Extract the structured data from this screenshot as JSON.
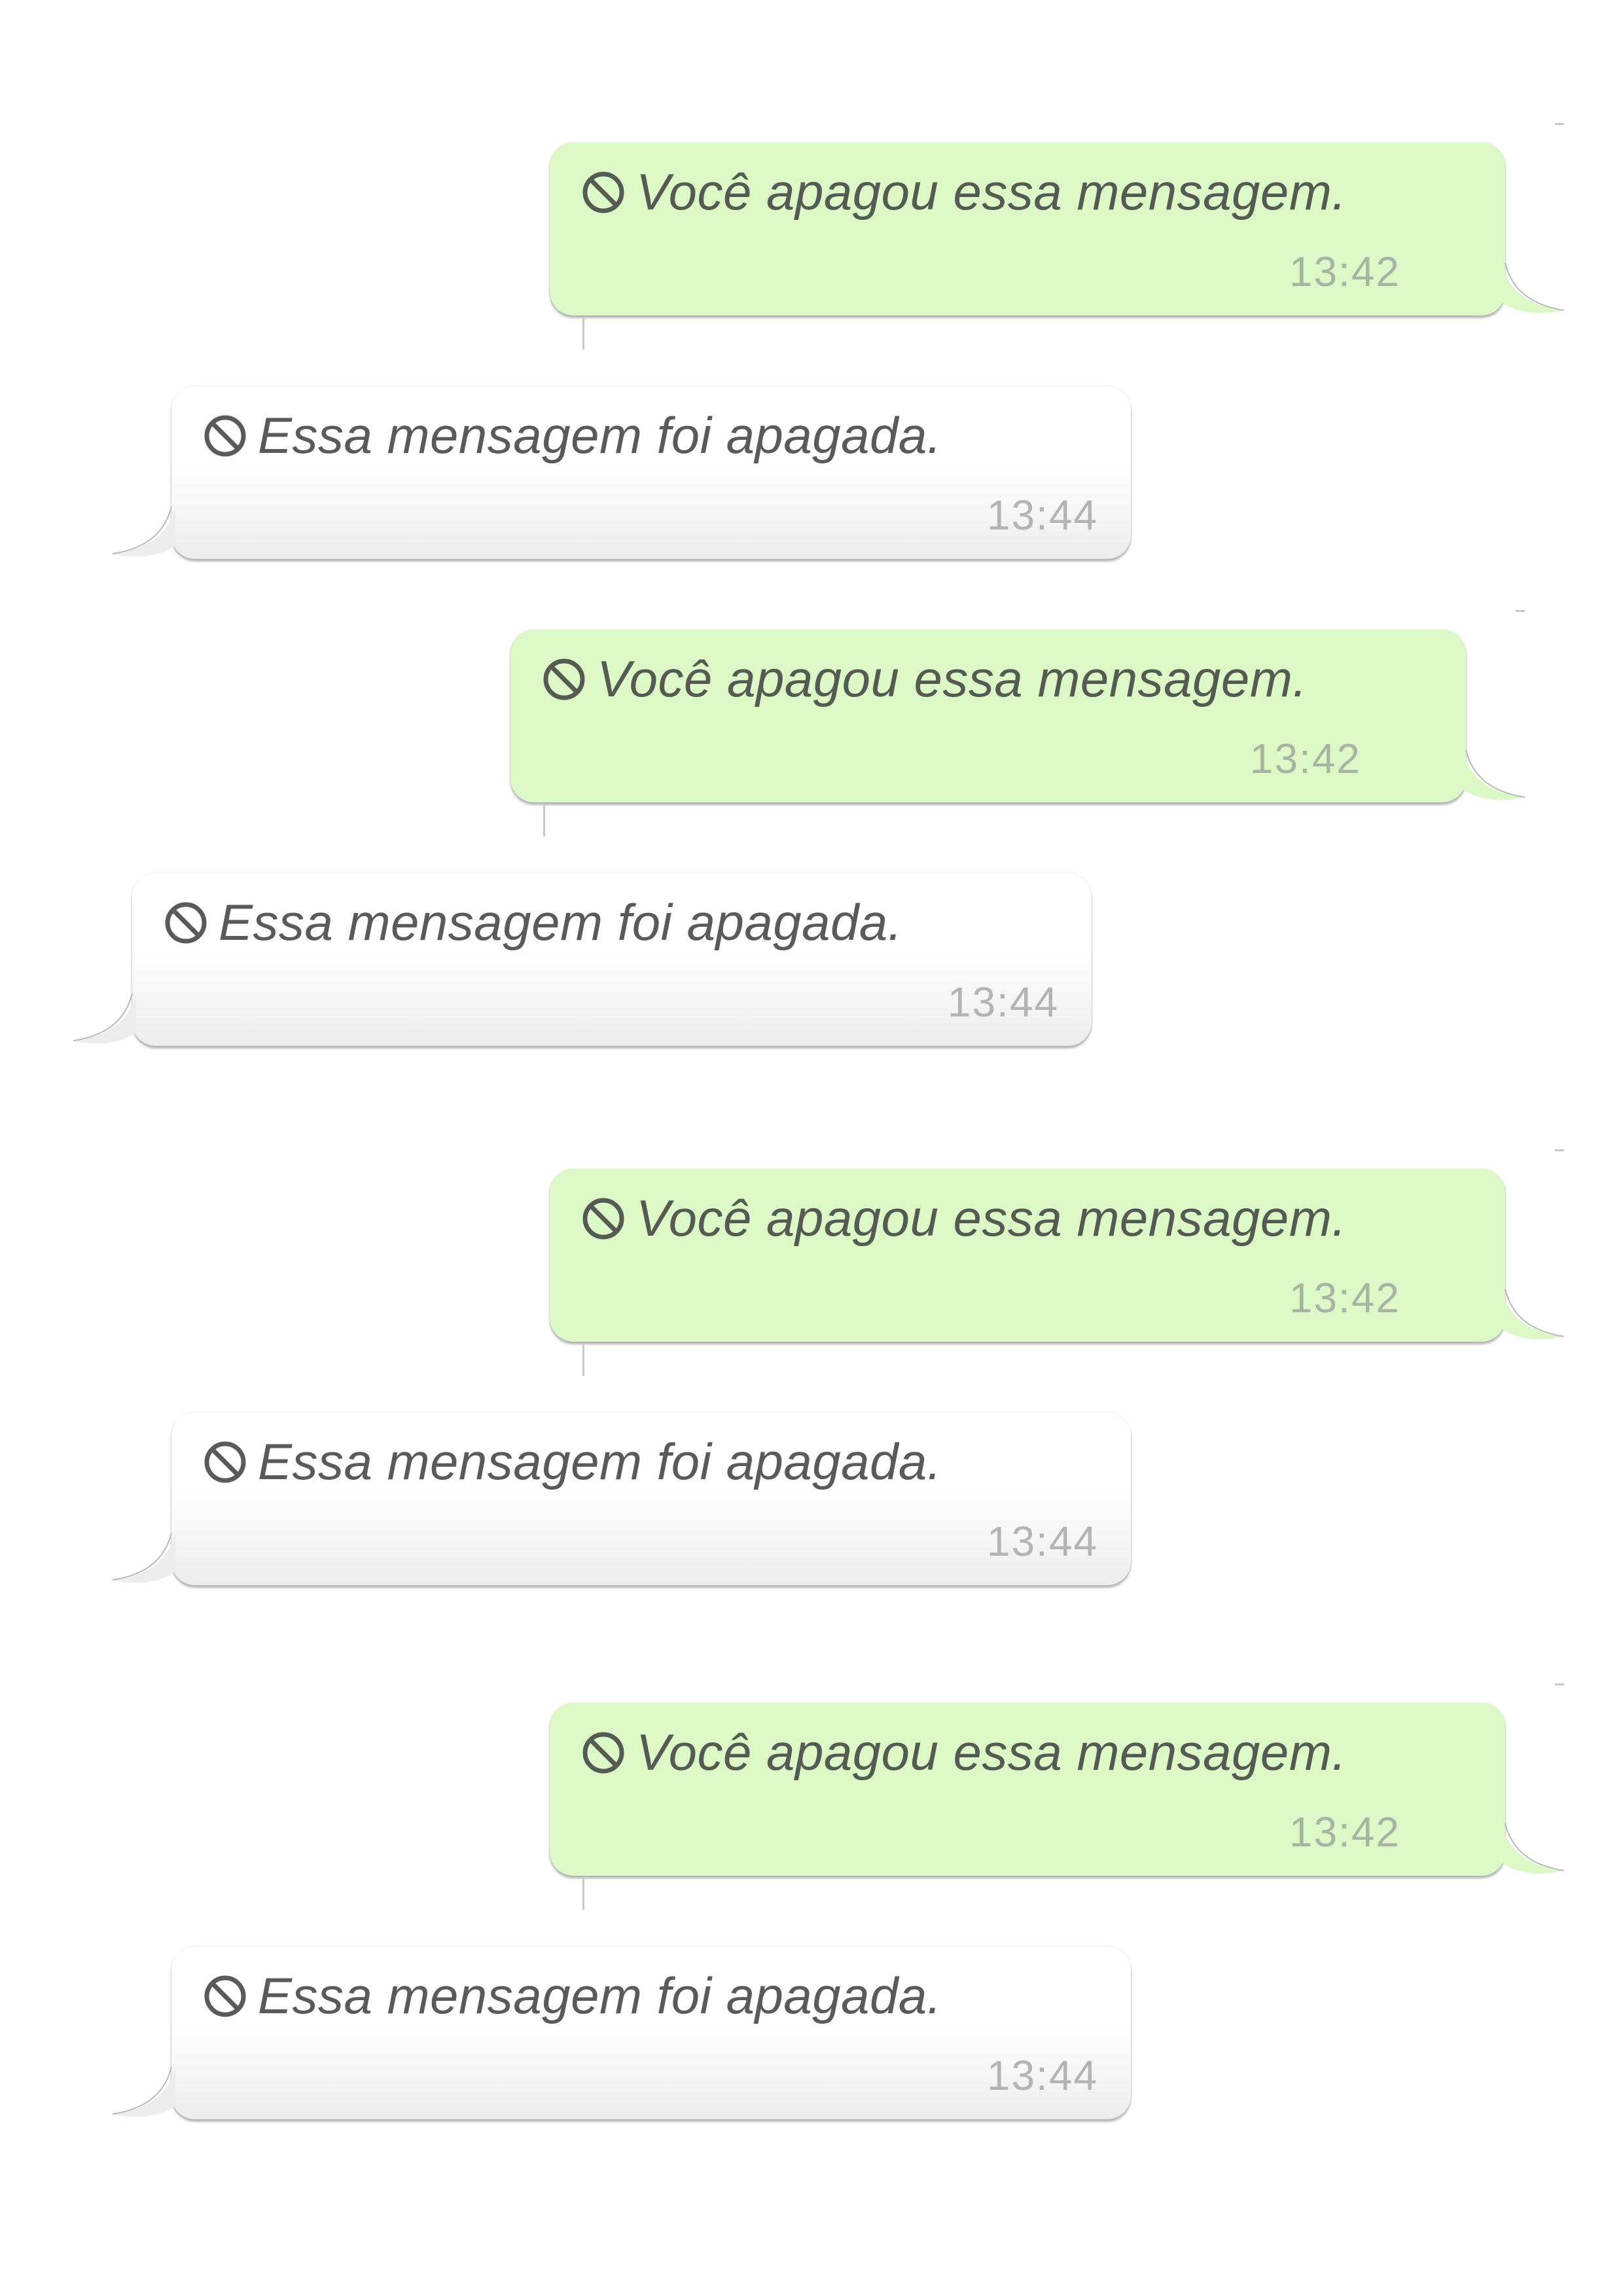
{
  "messages": [
    {
      "direction": "out",
      "text": "Você apagou essa mensagem.",
      "time": "13:42",
      "icon": "ban-icon"
    },
    {
      "direction": "in",
      "text": "Essa mensagem foi apagada.",
      "time": "13:44",
      "icon": "ban-icon"
    },
    {
      "direction": "out",
      "text": "Você apagou essa mensagem.",
      "time": "13:42",
      "icon": "ban-icon"
    },
    {
      "direction": "in",
      "text": "Essa mensagem foi apagada.",
      "time": "13:44",
      "icon": "ban-icon"
    },
    {
      "direction": "out",
      "text": "Você apagou essa mensagem.",
      "time": "13:42",
      "icon": "ban-icon"
    },
    {
      "direction": "in",
      "text": "Essa mensagem foi apagada.",
      "time": "13:44",
      "icon": "ban-icon"
    },
    {
      "direction": "out",
      "text": "Você apagou essa mensagem.",
      "time": "13:42",
      "icon": "ban-icon"
    },
    {
      "direction": "in",
      "text": "Essa mensagem foi apagada.",
      "time": "13:44",
      "icon": "ban-icon"
    }
  ],
  "colors": {
    "outgoing_bubble": "#dcf8c6",
    "incoming_bubble": "#ffffff",
    "text": "#555b53",
    "outgoing_time": "#a7b4a2",
    "incoming_time": "#b3b3b3"
  }
}
